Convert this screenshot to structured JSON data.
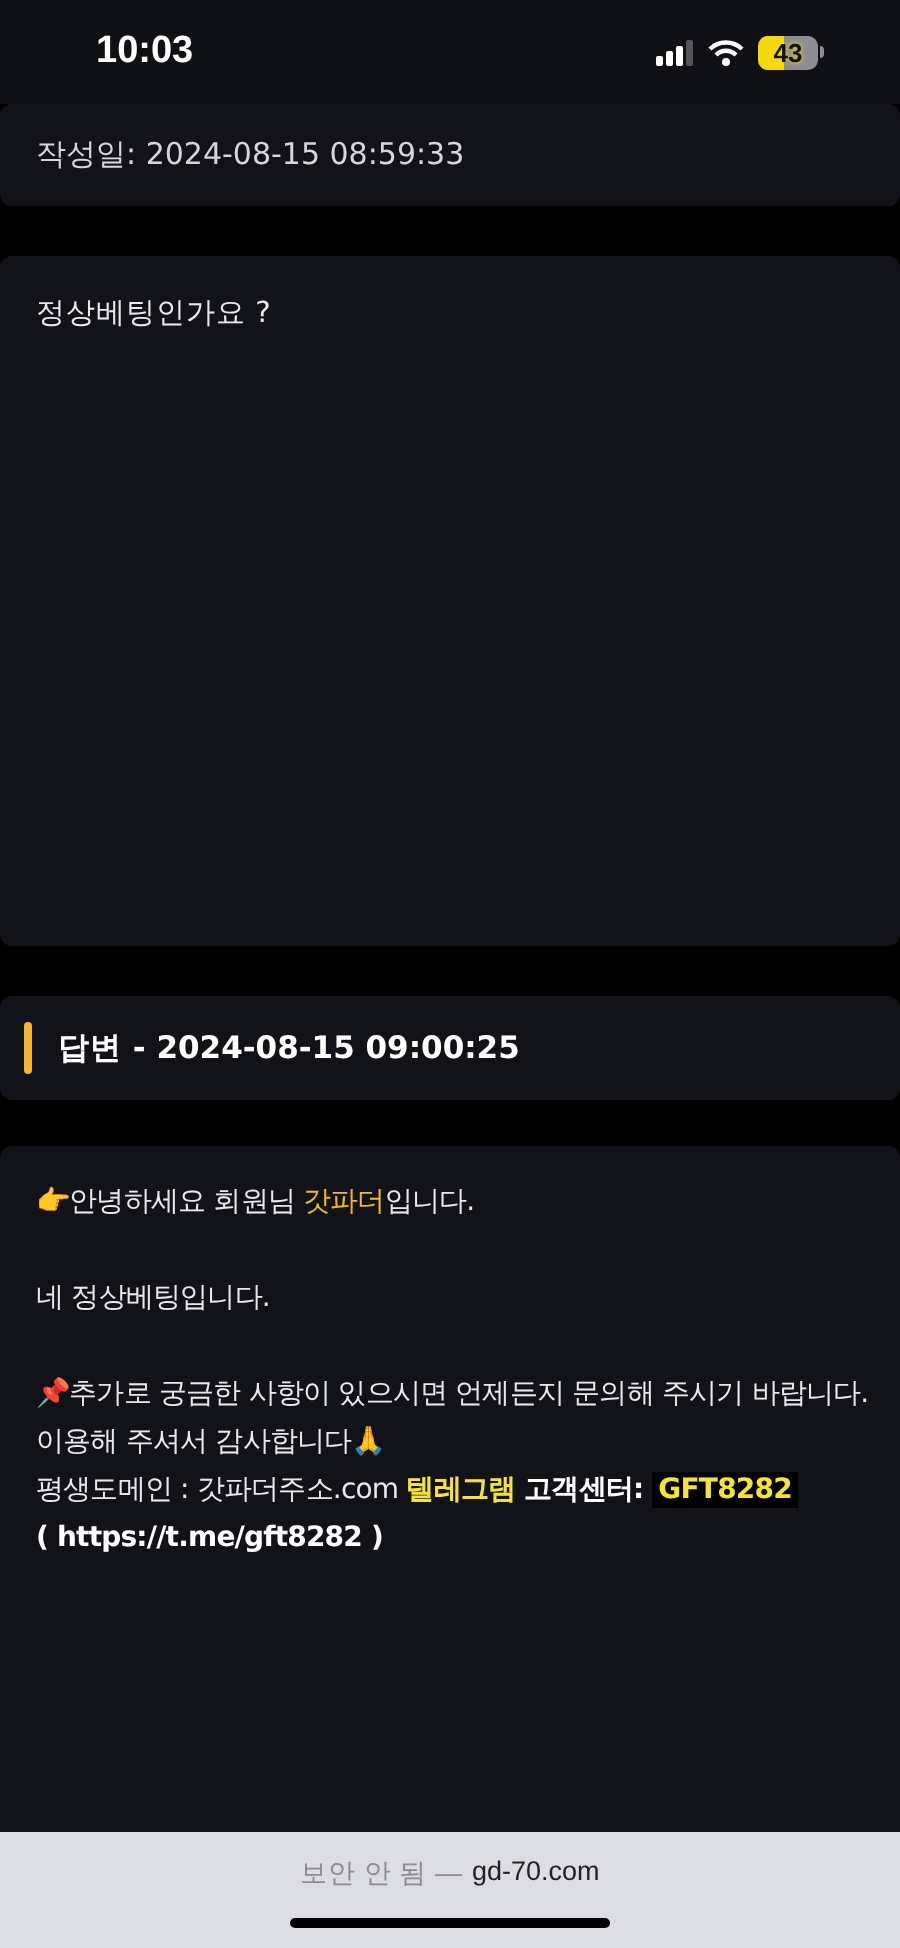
{
  "status_bar": {
    "time": "10:03",
    "battery": "43"
  },
  "post": {
    "date_label": "작성일: 2024-08-15 08:59:33",
    "body": "정상베팅인가요 ?"
  },
  "answer": {
    "title": "답변 - 2024-08-15 09:00:25",
    "blocks": [
      [
        [
          {
            "kind": "plain",
            "text": "👉안녕하세요 회원님 "
          },
          {
            "kind": "brand",
            "text": "갓파더"
          },
          {
            "kind": "plain",
            "text": "입니다."
          }
        ]
      ],
      [
        [
          {
            "kind": "plain",
            "text": "네 정상베팅입니다."
          }
        ]
      ],
      [
        [
          {
            "kind": "plain",
            "text": "📌추가로 궁금한 사항이 있으시면 언제든지 문의해 주시기 바랍니다."
          }
        ],
        [
          {
            "kind": "plain",
            "text": "이용해 주셔서 감사합니다🙏"
          }
        ],
        [
          {
            "kind": "plain",
            "text": "평생도메인 : 갓파더주소.com "
          },
          {
            "kind": "highlight",
            "text": "텔레그램"
          },
          {
            "kind": "bold",
            "text": " 고객센터: "
          },
          {
            "kind": "code",
            "text": "GFT8282"
          }
        ],
        [
          {
            "kind": "bold",
            "text": "( https://t.me/gft8282 )"
          }
        ]
      ]
    ]
  },
  "address_bar": {
    "security": "보안 안 됨 —",
    "domain": "gd-70.com"
  }
}
